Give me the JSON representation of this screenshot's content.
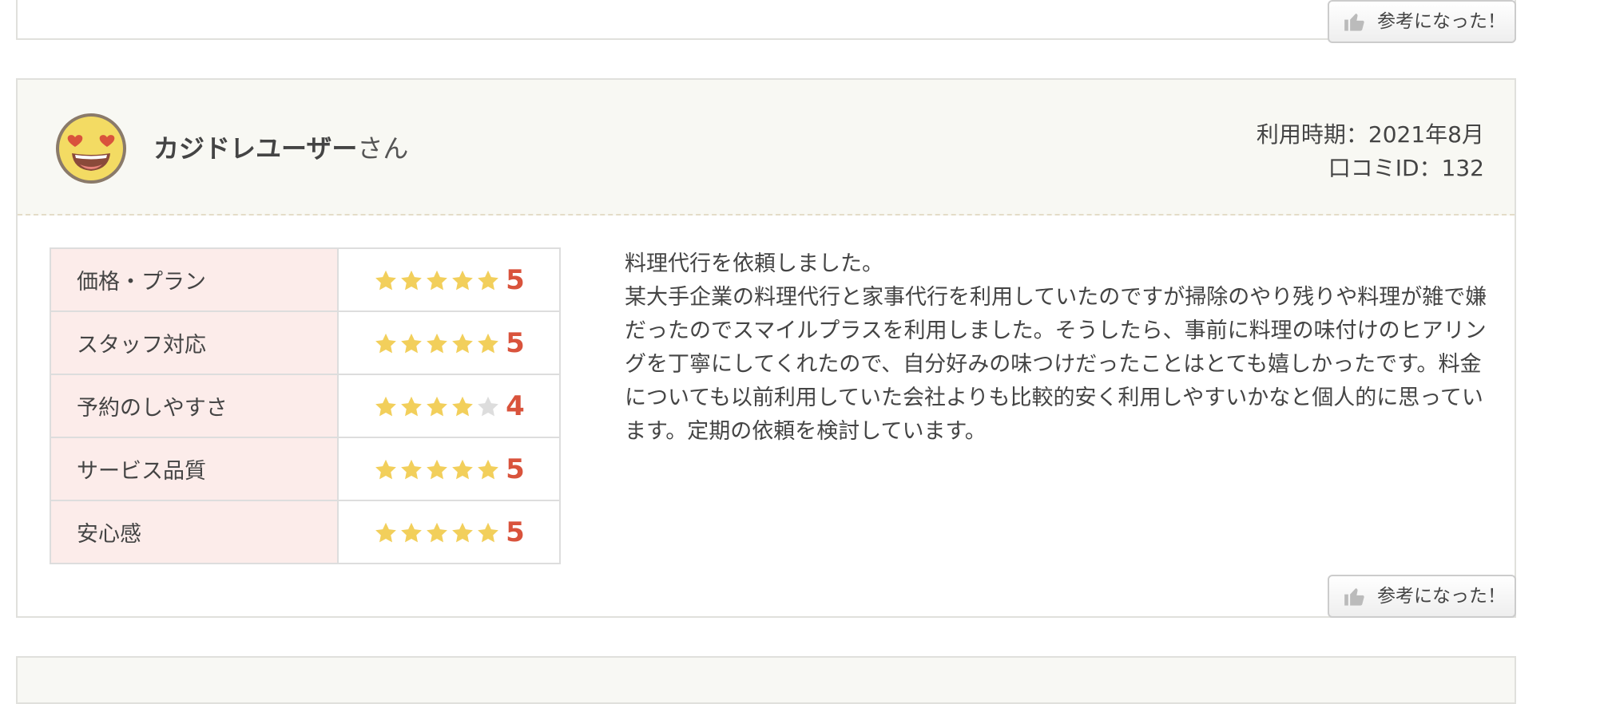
{
  "helpful_label": "参考になった！",
  "review": {
    "reviewer_name": "カジドレユーザー",
    "honorific": "さん",
    "usage_period": "利用時期：2021年8月",
    "review_id": "口コミID：132",
    "ratings": [
      {
        "label": "価格・プラン",
        "value": 5,
        "value_text": "5"
      },
      {
        "label": "スタッフ対応",
        "value": 5,
        "value_text": "5"
      },
      {
        "label": "予約のしやすさ",
        "value": 4,
        "value_text": "4"
      },
      {
        "label": "サービス品質",
        "value": 5,
        "value_text": "5"
      },
      {
        "label": "安心感",
        "value": 5,
        "value_text": "5"
      }
    ],
    "body_lines": [
      "料理代行を依頼しました。",
      "某大手企業の料理代行と家事代行を利用していたのですが掃除のやり残りや料理が雑で嫌だったのでスマイルプラスを利用しました。そうしたら、事前に料理の味付けのヒアリングを丁寧にしてくれたので、自分好みの味つけだったことはとても嬉しかったです。料金についても以前利用していた会社よりも比較的安く利用しやすいかなと個人的に思っています。定期の依頼を検討しています。"
    ]
  },
  "colors": {
    "star_filled": "#f2cf5b",
    "star_empty": "#dddddd",
    "score_number": "#d9533c",
    "label_bg": "#fcecea",
    "header_bg": "#f8f8f3"
  }
}
